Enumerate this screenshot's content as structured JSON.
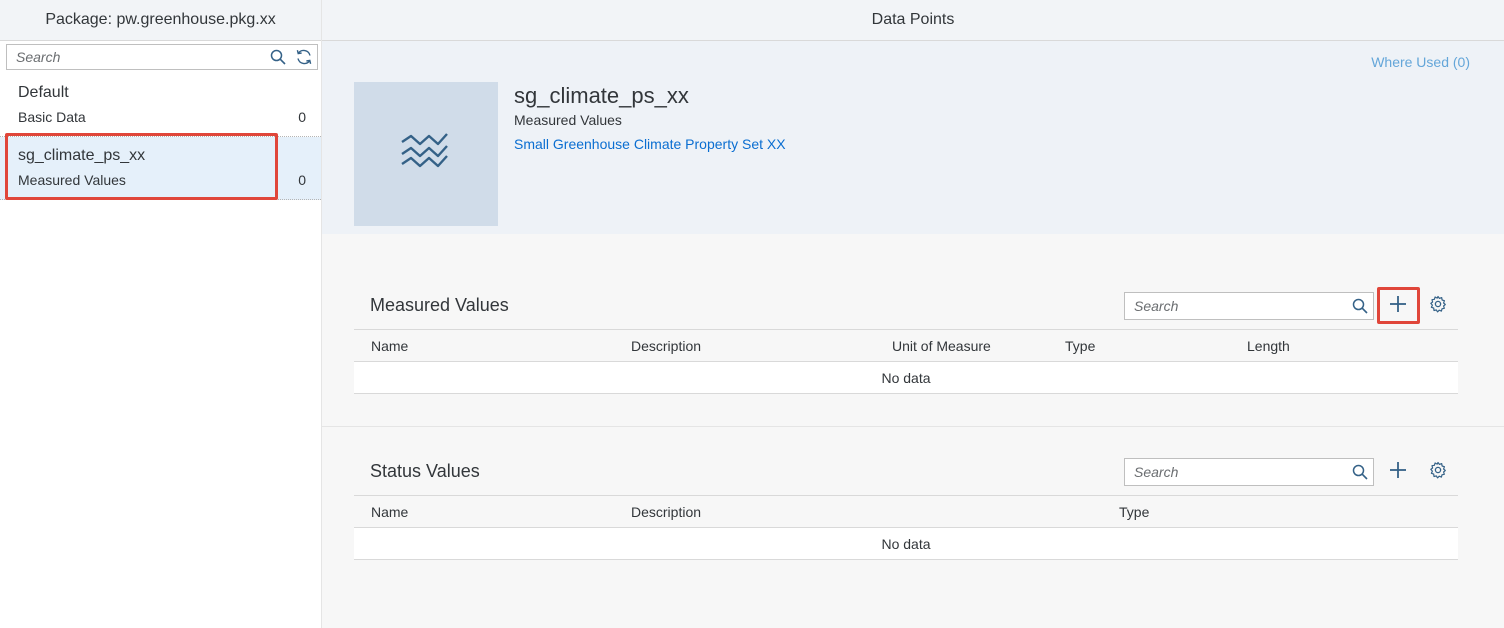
{
  "master": {
    "title": "Package: pw.greenhouse.pkg.xx",
    "search_placeholder": "Search",
    "items": [
      {
        "title": "Default",
        "subtitle": "Basic Data",
        "count": "0"
      },
      {
        "title": "sg_climate_ps_xx",
        "subtitle": "Measured Values",
        "count": "0"
      }
    ]
  },
  "detail": {
    "title": "Data Points",
    "where_used": "Where Used (0)",
    "object": {
      "title": "sg_climate_ps_xx",
      "subtitle": "Measured Values",
      "description": "Small Greenhouse Climate Property Set XX"
    },
    "measured": {
      "title": "Measured Values",
      "search_placeholder": "Search",
      "columns": [
        "Name",
        "Description",
        "Unit of Measure",
        "Type",
        "Length"
      ],
      "no_data": "No data"
    },
    "status": {
      "title": "Status Values",
      "search_placeholder": "Search",
      "columns": [
        "Name",
        "Description",
        "Type"
      ],
      "no_data": "No data"
    }
  },
  "icons": [
    "search-icon",
    "refresh-icon",
    "data-wave-icon",
    "add-icon",
    "settings-icon"
  ],
  "colors": {
    "accent": "#0a6ed1",
    "highlight": "#e0463a",
    "selected_bg": "#e5f0fa"
  }
}
